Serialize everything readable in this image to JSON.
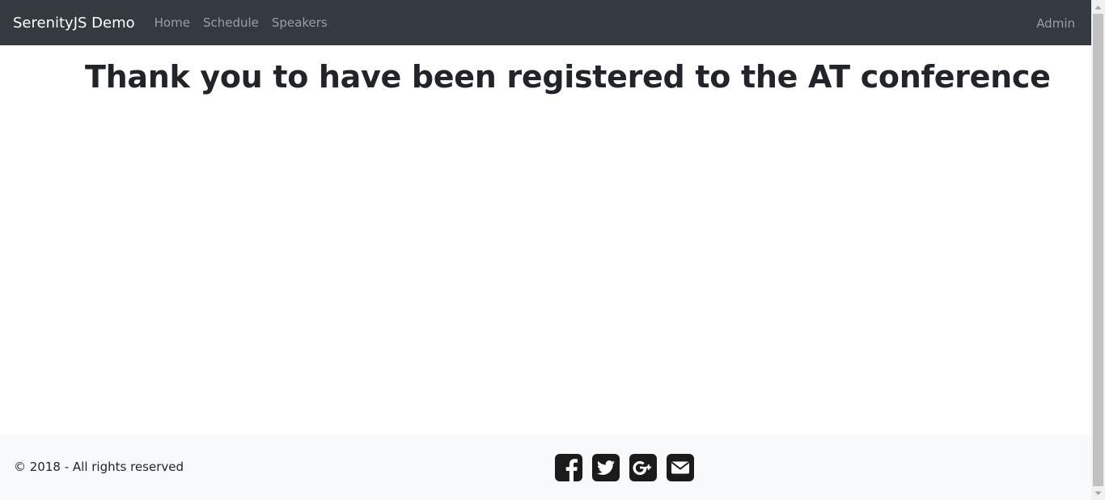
{
  "navbar": {
    "brand": "SerenityJS Demo",
    "links": [
      "Home",
      "Schedule",
      "Speakers"
    ],
    "admin": "Admin"
  },
  "main": {
    "title": "Thank you to have been registered to the AT conference"
  },
  "footer": {
    "copyright": "© 2018 - All rights reserved",
    "social_icons": [
      "facebook-icon",
      "twitter-icon",
      "google-plus-icon",
      "envelope-icon"
    ]
  },
  "colors": {
    "navbar_bg": "#343a40",
    "footer_bg": "#f8f9fa",
    "text": "#212529"
  }
}
